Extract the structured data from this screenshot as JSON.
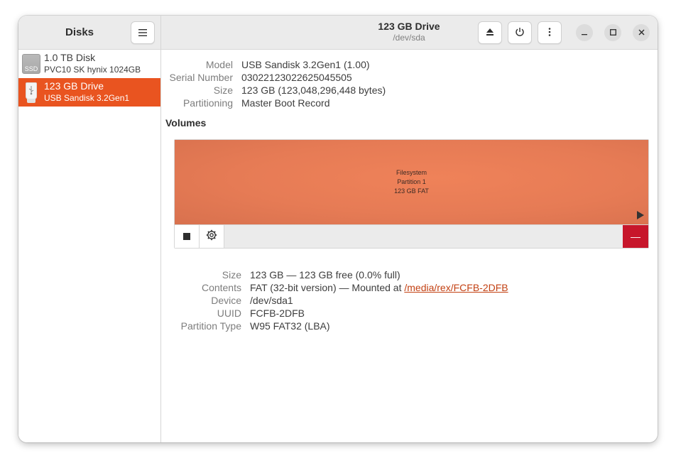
{
  "sidebar": {
    "title": "Disks",
    "items": [
      {
        "name": "1.0 TB Disk",
        "model": "PVC10 SK hynix 1024GB",
        "icon_label": "SSD",
        "selected": false
      },
      {
        "name": "123 GB Drive",
        "model": "USB Sandisk 3.2Gen1",
        "icon_label": "",
        "selected": true
      }
    ]
  },
  "header": {
    "title": "123 GB Drive",
    "subtitle": "/dev/sda"
  },
  "drive_info": {
    "model_label": "Model",
    "model_value": "USB Sandisk 3.2Gen1 (1.00)",
    "serial_label": "Serial Number",
    "serial_value": "03022123022625045505",
    "size_label": "Size",
    "size_value": "123 GB (123,048,296,448 bytes)",
    "partitioning_label": "Partitioning",
    "partitioning_value": "Master Boot Record"
  },
  "volumes": {
    "heading": "Volumes",
    "partition_line1": "Filesystem",
    "partition_line2": "Partition 1",
    "partition_line3": "123 GB FAT",
    "delete_label": "—"
  },
  "partition_info": {
    "size_label": "Size",
    "size_value": "123 GB — 123 GB free (0.0% full)",
    "contents_label": "Contents",
    "contents_value": "FAT (32-bit version) — Mounted at",
    "contents_link": "/media/rex/FCFB-2DFB",
    "device_label": "Device",
    "device_value": "/dev/sda1",
    "uuid_label": "UUID",
    "uuid_value": "FCFB-2DFB",
    "type_label": "Partition Type",
    "type_value": "W95 FAT32 (LBA)"
  },
  "colors": {
    "accent": "#e95420",
    "partition": "#e67b55",
    "delete": "#c7162b",
    "link": "#c34113"
  }
}
